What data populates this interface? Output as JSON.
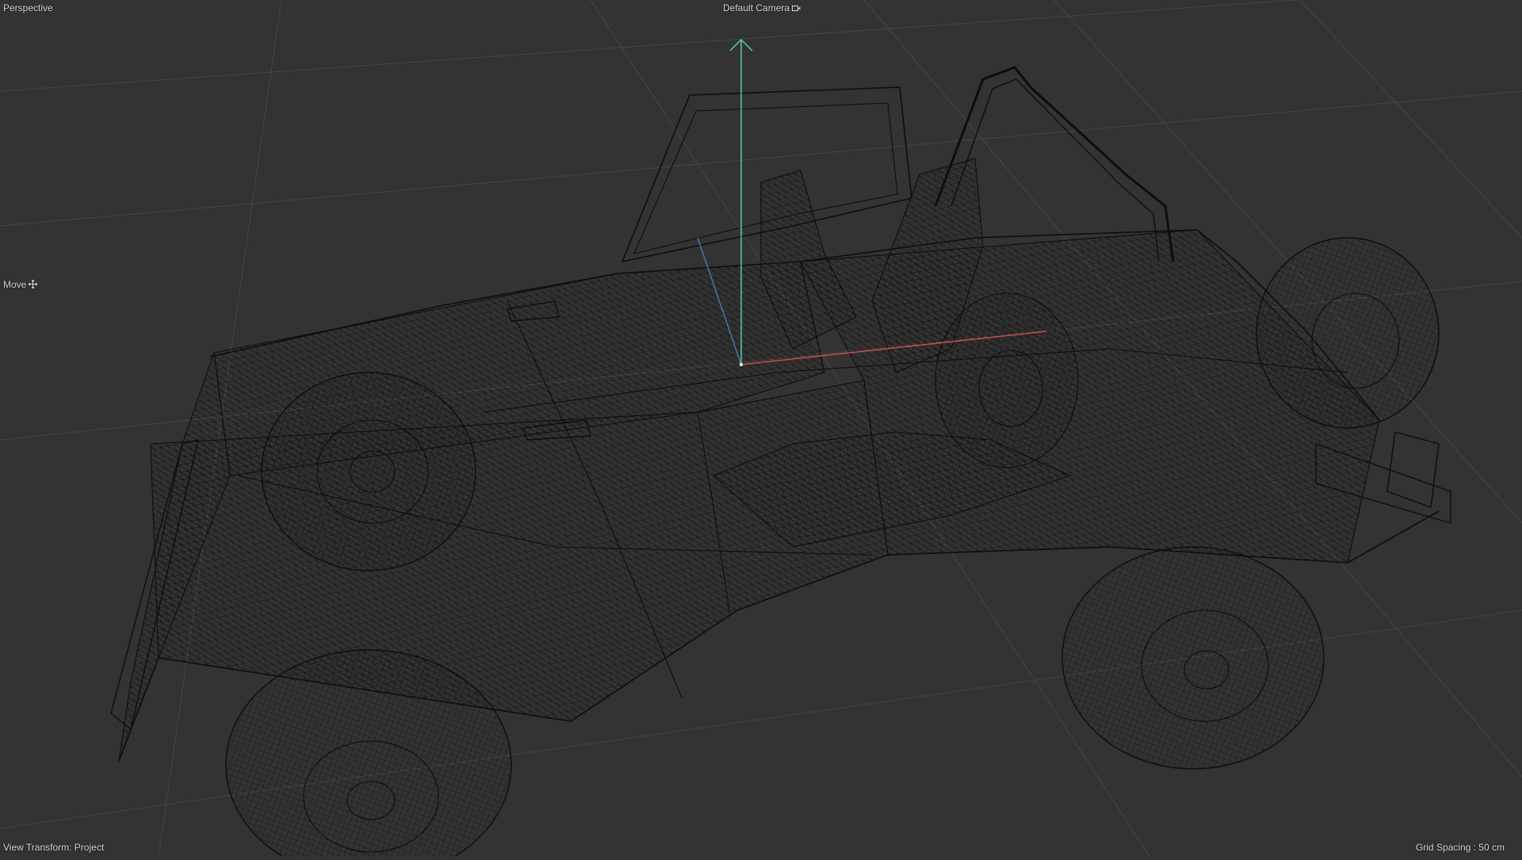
{
  "viewport": {
    "projection_label": "Perspective",
    "camera_label": "Default Camera",
    "camera_icon": "camera-icon",
    "tool_label": "Move",
    "tool_icon": "move-icon",
    "view_transform_label": "View Transform: Project",
    "grid_spacing_label": "Grid Spacing : 50 cm",
    "object": "jeep wireframe model",
    "colors": {
      "background": "#333333",
      "grid": "#474747",
      "wire": "#0d0d0d",
      "axis_y": "#4fd39a",
      "axis_x": "#c0504f",
      "axis_z": "#4f6fb0",
      "text": "#d8d8d8"
    }
  }
}
